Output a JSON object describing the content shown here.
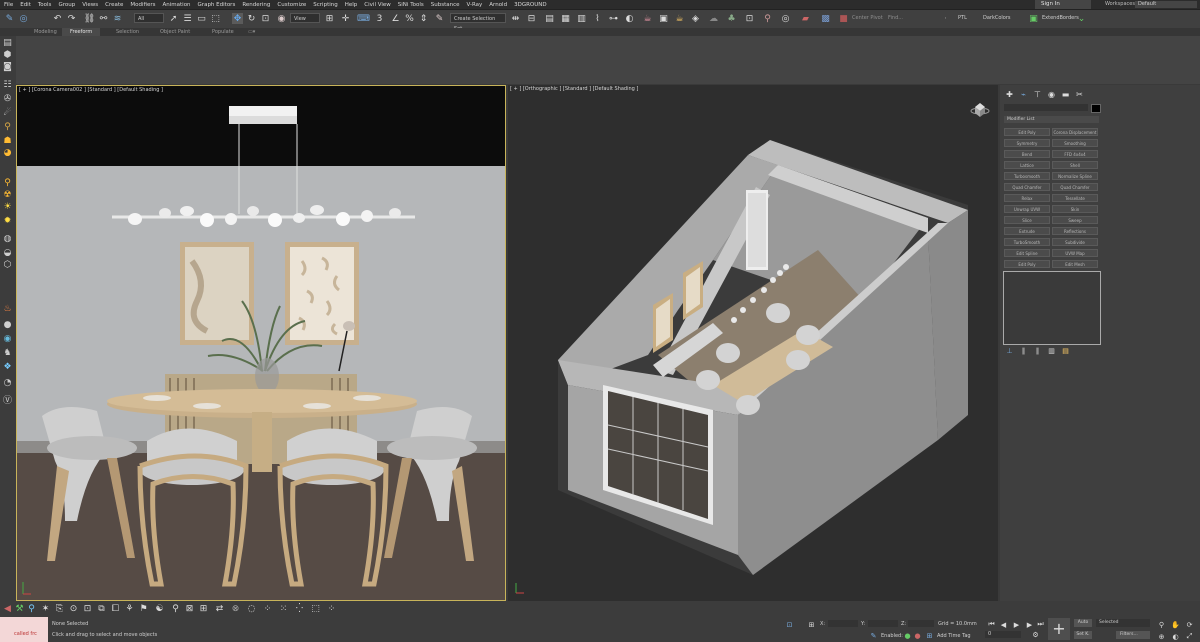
{
  "menu": [
    "File",
    "Edit",
    "Tools",
    "Group",
    "Views",
    "Create",
    "Modifiers",
    "Animation",
    "Graph Editors",
    "Rendering",
    "Customize",
    "Scripting",
    "Help",
    "Civil View",
    "SiNi Tools",
    "Substance",
    "V-Ray",
    "Arnold",
    "3DGROUND"
  ],
  "signin": "Sign In",
  "workspaces_label": "Workspaces:",
  "workspaces_value": "Default",
  "toolbar": {
    "filter": "All",
    "coord": "View",
    "selection_set": "Create Selection Set",
    "center_pivot": "Center Pivot",
    "file_label": "Find...",
    "ptl": "PTL",
    "darkcolors": "DarkColors",
    "extend_borders": "ExtendBorders"
  },
  "ribbon_tabs": [
    "Modeling",
    "Freeform",
    "Selection",
    "Object Paint",
    "Populate"
  ],
  "viewport_left": {
    "label": "[ + ] [Corona Camera002 ] [Standard ] [Default Shading ]"
  },
  "viewport_right": {
    "label": "[ + ] [Orthographic ] [Standard ] [Default Shading ]"
  },
  "command_panel": {
    "category": "Modifier List",
    "buttons": [
      [
        "Edit Poly",
        "Corona Displacement"
      ],
      [
        "Symmetry",
        "Smoothing"
      ],
      [
        "Bend",
        "FFD 4x4x4"
      ],
      [
        "Lattice",
        "Shell"
      ],
      [
        "Turbosmooth",
        "Normalize Spline"
      ],
      [
        "Quad Chamfer",
        "Quad Chamfer"
      ],
      [
        "Relax",
        "Tessellate"
      ],
      [
        "Unwrap UVW",
        "Skin"
      ],
      [
        "Slice",
        "Sweep"
      ],
      [
        "Extrude",
        "Reflections"
      ],
      [
        "TurboSmooth",
        "Subdivide"
      ],
      [
        "Edit Spline",
        "UVW Map"
      ],
      [
        "Edit Poly",
        "Edit Mesh"
      ]
    ]
  },
  "status": {
    "selection": "None Selected",
    "prompt": "Click and drag to select and move objects",
    "script_prompt": "called frc",
    "x_label": "X:",
    "y_label": "Y:",
    "z_label": "Z:",
    "grid": "Grid = 10.0mm",
    "enabled": "Enabled:",
    "add_time_tag": "Add Time Tag",
    "auto": "Auto",
    "selected": "Selected",
    "set_k": "Set K.",
    "filters": "Filters...",
    "frame": "0"
  }
}
